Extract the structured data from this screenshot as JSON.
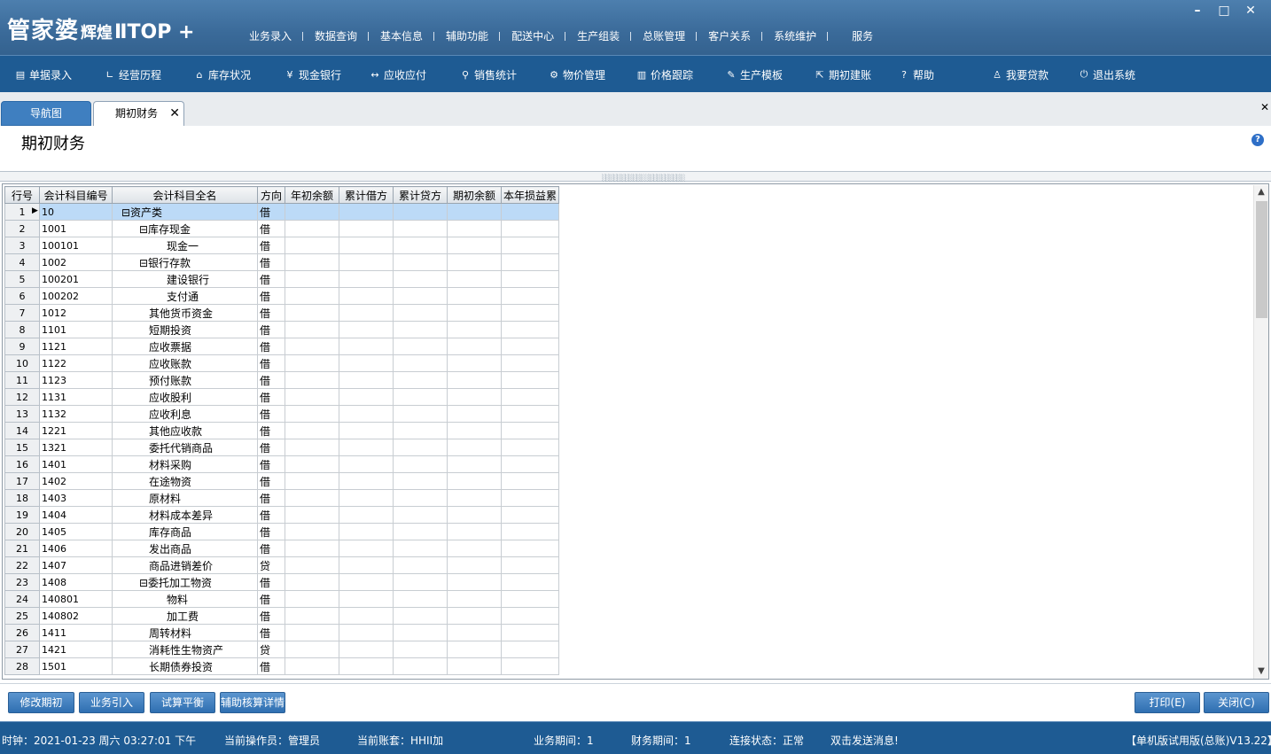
{
  "app": {
    "logo_main": "管家婆",
    "logo_sub": "辉煌",
    "logo_edition": "ⅡTOP +"
  },
  "window_controls": {
    "minimize": "–",
    "maximize": "□",
    "close": "✕"
  },
  "top_menu": [
    "业务录入",
    "数据查询",
    "基本信息",
    "辅助功能",
    "配送中心",
    "生产组装",
    "总账管理",
    "客户关系",
    "系统维护",
    "服务"
  ],
  "toolbar": [
    {
      "label": "单据录入",
      "icon": "document-icon"
    },
    {
      "label": "经营历程",
      "icon": "chart-line-icon"
    },
    {
      "label": "库存状况",
      "icon": "warehouse-icon"
    },
    {
      "label": "现金银行",
      "icon": "yen-icon"
    },
    {
      "label": "应收应付",
      "icon": "exchange-icon"
    },
    {
      "label": "销售统计",
      "icon": "search-icon"
    },
    {
      "label": "物价管理",
      "icon": "gear-icon"
    },
    {
      "label": "价格跟踪",
      "icon": "bar-chart-icon"
    },
    {
      "label": "生产模板",
      "icon": "wrench-icon"
    },
    {
      "label": "期初建账",
      "icon": "external-icon"
    },
    {
      "label": "帮助",
      "icon": "question-icon"
    },
    {
      "label": "我要贷款",
      "icon": "moneybag-icon"
    },
    {
      "label": "退出系统",
      "icon": "power-icon"
    }
  ],
  "tabs": {
    "nav": "导航图",
    "active": "期初财务",
    "close": "✕"
  },
  "page": {
    "title": "期初财务",
    "help": "?"
  },
  "grid": {
    "columns": [
      "行号",
      "会计科目编号",
      "会计科目全名",
      "方向",
      "年初余额",
      "累计借方",
      "累计贷方",
      "期初余额",
      "本年损益累"
    ],
    "rows": [
      {
        "n": "1",
        "code": "10",
        "name": "⊟资产类",
        "dir": "借",
        "level": 0
      },
      {
        "n": "2",
        "code": "1001",
        "name": "⊟库存现金",
        "dir": "借",
        "level": 1
      },
      {
        "n": "3",
        "code": "100101",
        "name": "现金一",
        "dir": "借",
        "level": 3
      },
      {
        "n": "4",
        "code": "1002",
        "name": "⊟银行存款",
        "dir": "借",
        "level": 1
      },
      {
        "n": "5",
        "code": "100201",
        "name": "建设银行",
        "dir": "借",
        "level": 3
      },
      {
        "n": "6",
        "code": "100202",
        "name": "支付通",
        "dir": "借",
        "level": 3
      },
      {
        "n": "7",
        "code": "1012",
        "name": "其他货币资金",
        "dir": "借",
        "level": 2
      },
      {
        "n": "8",
        "code": "1101",
        "name": "短期投资",
        "dir": "借",
        "level": 2
      },
      {
        "n": "9",
        "code": "1121",
        "name": "应收票据",
        "dir": "借",
        "level": 2
      },
      {
        "n": "10",
        "code": "1122",
        "name": "应收账款",
        "dir": "借",
        "level": 2
      },
      {
        "n": "11",
        "code": "1123",
        "name": "预付账款",
        "dir": "借",
        "level": 2
      },
      {
        "n": "12",
        "code": "1131",
        "name": "应收股利",
        "dir": "借",
        "level": 2
      },
      {
        "n": "13",
        "code": "1132",
        "name": "应收利息",
        "dir": "借",
        "level": 2
      },
      {
        "n": "14",
        "code": "1221",
        "name": "其他应收款",
        "dir": "借",
        "level": 2
      },
      {
        "n": "15",
        "code": "1321",
        "name": "委托代销商品",
        "dir": "借",
        "level": 2
      },
      {
        "n": "16",
        "code": "1401",
        "name": "材料采购",
        "dir": "借",
        "level": 2
      },
      {
        "n": "17",
        "code": "1402",
        "name": "在途物资",
        "dir": "借",
        "level": 2
      },
      {
        "n": "18",
        "code": "1403",
        "name": "原材料",
        "dir": "借",
        "level": 2
      },
      {
        "n": "19",
        "code": "1404",
        "name": "材料成本差异",
        "dir": "借",
        "level": 2
      },
      {
        "n": "20",
        "code": "1405",
        "name": "库存商品",
        "dir": "借",
        "level": 2
      },
      {
        "n": "21",
        "code": "1406",
        "name": "发出商品",
        "dir": "借",
        "level": 2
      },
      {
        "n": "22",
        "code": "1407",
        "name": "商品进销差价",
        "dir": "贷",
        "level": 2
      },
      {
        "n": "23",
        "code": "1408",
        "name": "⊟委托加工物资",
        "dir": "借",
        "level": 1
      },
      {
        "n": "24",
        "code": "140801",
        "name": "物料",
        "dir": "借",
        "level": 3
      },
      {
        "n": "25",
        "code": "140802",
        "name": "加工费",
        "dir": "借",
        "level": 3
      },
      {
        "n": "26",
        "code": "1411",
        "name": "周转材料",
        "dir": "借",
        "level": 2
      },
      {
        "n": "27",
        "code": "1421",
        "name": "消耗性生物资产",
        "dir": "贷",
        "level": 2
      },
      {
        "n": "28",
        "code": "1501",
        "name": "长期债券投资",
        "dir": "借",
        "level": 2
      }
    ]
  },
  "buttons": {
    "modify": "修改期初",
    "import": "业务引入",
    "trial": "试算平衡",
    "aux": "辅助核算详情",
    "print": "打印(E)",
    "close": "关闭(C)"
  },
  "status": {
    "clock": "时钟：2021-01-23 周六 03:27:01 下午",
    "operator": "当前操作员：管理员",
    "account": "当前账套：HHII加",
    "biz_period": "业务期间：1",
    "fin_period": "财务期间：1",
    "connection": "连接状态：正常",
    "message": "双击发送消息!",
    "version": "【单机版试用版(总账)V13.22】"
  }
}
